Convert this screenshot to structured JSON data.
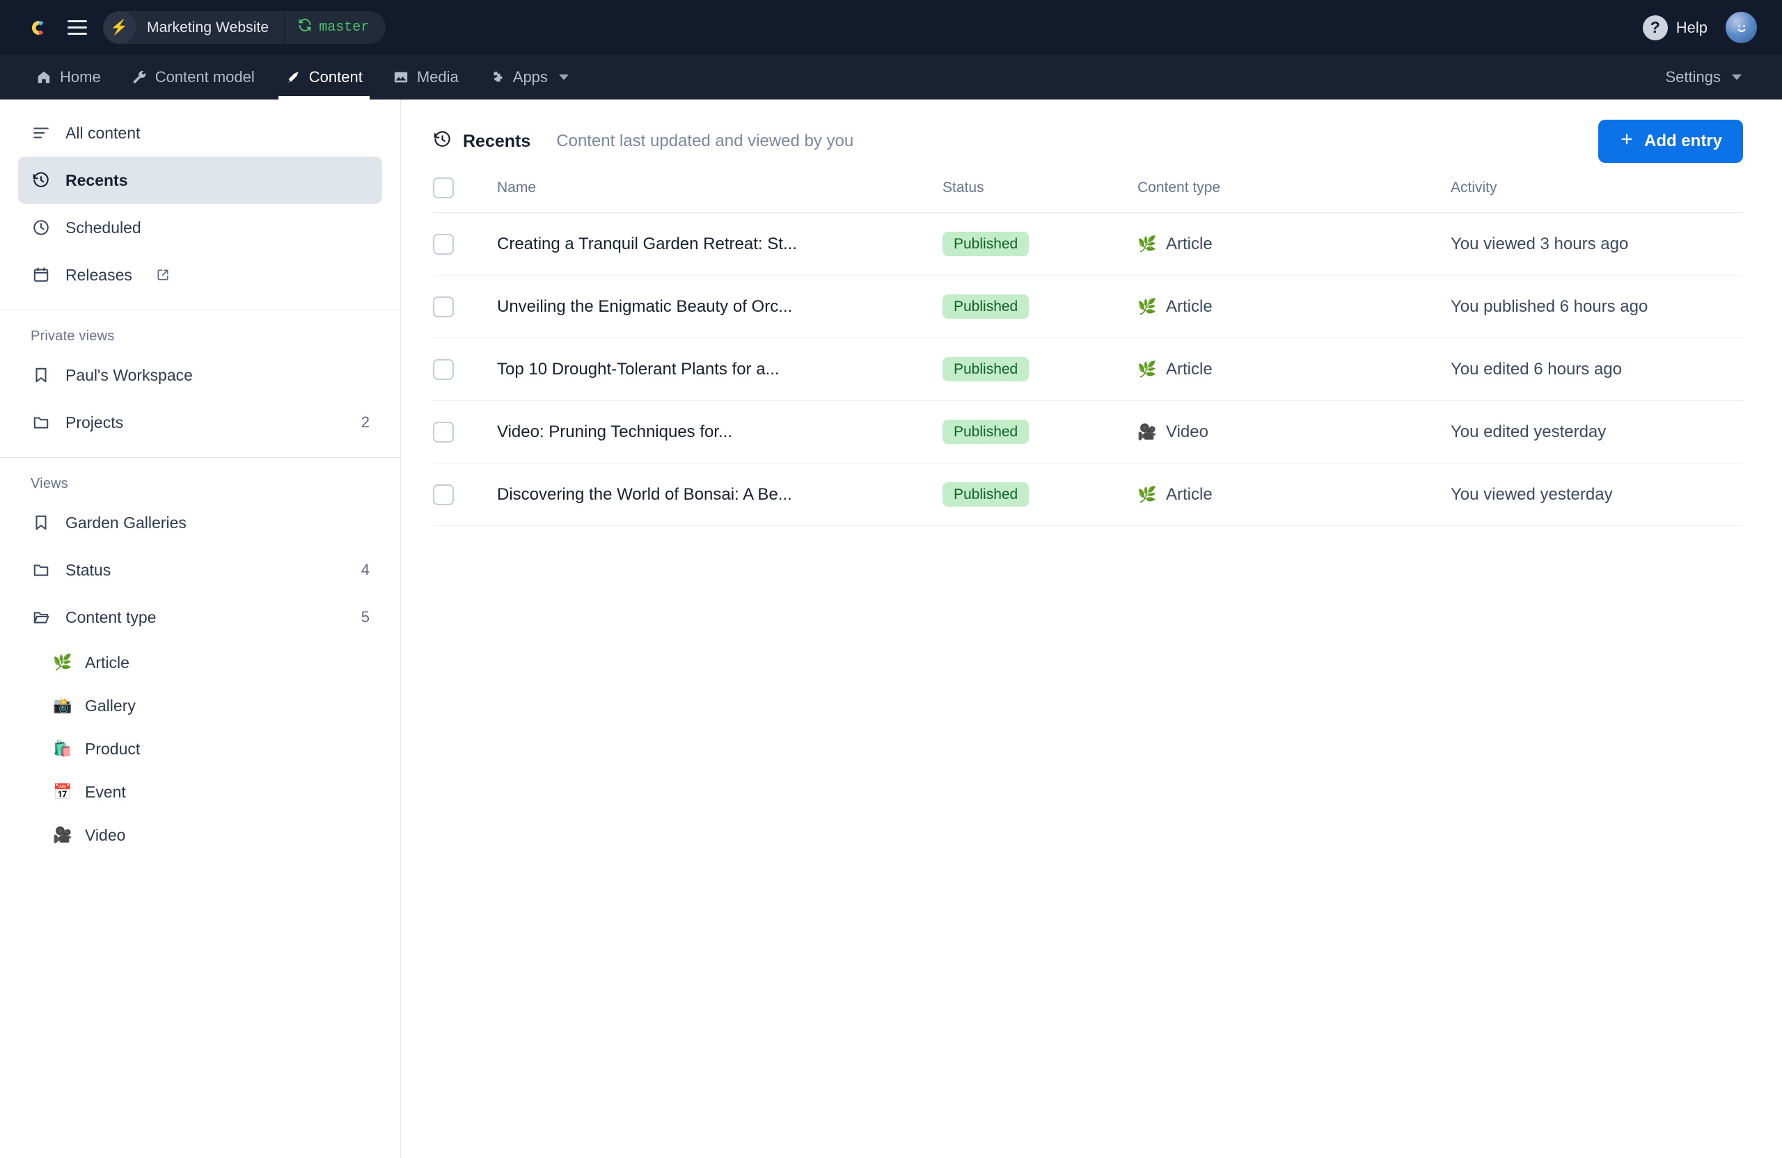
{
  "topbar": {
    "logo_icon": "contentful-logo-icon",
    "menu_icon": "hamburger-menu-icon",
    "space_name": "Marketing Website",
    "bolt_icon": "lightning-bolt-icon",
    "branch_icon": "branch-sync-icon",
    "branch_name": "master",
    "help_label": "Help",
    "help_icon": "question-mark-icon",
    "avatar_icon": "user-avatar-smiley-icon"
  },
  "nav": {
    "tabs": [
      {
        "label": "Home",
        "icon": "home-icon",
        "active": false
      },
      {
        "label": "Content model",
        "icon": "wrench-icon",
        "active": false
      },
      {
        "label": "Content",
        "icon": "pen-nib-icon",
        "active": true
      },
      {
        "label": "Media",
        "icon": "image-icon",
        "active": false
      },
      {
        "label": "Apps",
        "icon": "puzzle-piece-icon",
        "active": false,
        "has_caret": true
      }
    ],
    "settings_label": "Settings"
  },
  "sidebar": {
    "top_items": [
      {
        "label": "All content",
        "icon": "list-lines-icon",
        "active": false,
        "count": ""
      },
      {
        "label": "Recents",
        "icon": "clock-history-icon",
        "active": true,
        "count": ""
      },
      {
        "label": "Scheduled",
        "icon": "clock-icon",
        "active": false,
        "count": ""
      },
      {
        "label": "Releases",
        "icon": "calendar-icon",
        "active": false,
        "count": "",
        "external": true
      }
    ],
    "private_views_title": "Private views",
    "private_views": [
      {
        "label": "Paul's Workspace",
        "icon": "bookmark-icon",
        "count": ""
      },
      {
        "label": "Projects",
        "icon": "folder-icon",
        "count": "2"
      }
    ],
    "views_title": "Views",
    "views": [
      {
        "label": "Garden Galleries",
        "icon": "bookmark-icon",
        "count": ""
      },
      {
        "label": "Status",
        "icon": "folder-icon",
        "count": "4"
      },
      {
        "label": "Content type",
        "icon": "folder-open-icon",
        "count": "5"
      }
    ],
    "content_types": [
      {
        "label": "Article",
        "emoji": "🌿"
      },
      {
        "label": "Gallery",
        "emoji": "📸"
      },
      {
        "label": "Product",
        "emoji": "🛍️"
      },
      {
        "label": "Event",
        "emoji": "📅"
      },
      {
        "label": "Video",
        "emoji": "🎥"
      }
    ]
  },
  "main": {
    "view_title": "Recents",
    "view_title_icon": "clock-history-icon",
    "view_subtitle": "Content last updated and viewed by you",
    "add_entry_label": "Add entry",
    "add_entry_icon": "plus-icon",
    "columns": {
      "name": "Name",
      "status": "Status",
      "content_type": "Content type",
      "activity": "Activity"
    },
    "rows": [
      {
        "name": "Creating a Tranquil Garden Retreat: St...",
        "status": "Published",
        "content_type": "Article",
        "content_type_emoji": "🌿",
        "activity": "You viewed 3 hours ago"
      },
      {
        "name": "Unveiling the Enigmatic Beauty of Orc...",
        "status": "Published",
        "content_type": "Article",
        "content_type_emoji": "🌿",
        "activity": "You published 6 hours ago"
      },
      {
        "name": "Top 10 Drought-Tolerant Plants for a...",
        "status": "Published",
        "content_type": "Article",
        "content_type_emoji": "🌿",
        "activity": "You edited 6 hours ago"
      },
      {
        "name": "Video: Pruning Techniques for...",
        "status": "Published",
        "content_type": "Video",
        "content_type_emoji": "🎥",
        "activity": "You edited yesterday"
      },
      {
        "name": "Discovering the World of Bonsai: A Be...",
        "status": "Published",
        "content_type": "Article",
        "content_type_emoji": "🌿",
        "activity": "You viewed yesterday"
      }
    ]
  },
  "colors": {
    "topbar_bg": "#111b2b",
    "navbar_bg": "#1a2130",
    "accent_blue": "#0b72e7",
    "branch_green": "#4ec26e",
    "badge_bg": "#c3ecc8",
    "badge_text": "#126227",
    "sidebar_active_bg": "#dfe5eb"
  }
}
